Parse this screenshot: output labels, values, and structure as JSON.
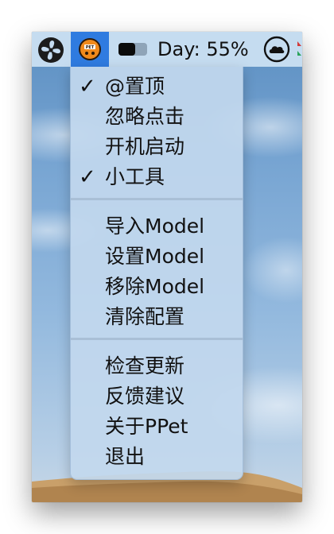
{
  "menubar": {
    "left_icon": "fan-icon",
    "app_icon": "ppet-app-icon",
    "app_icon_text": "PET",
    "battery_icon": "battery-toggle-icon",
    "status_text": "Day: 55%",
    "right_icon": "cloud-icon",
    "accent_color": "#2f7be0"
  },
  "menu": {
    "items": [
      {
        "label": "@置顶",
        "checked": true
      },
      {
        "label": "忽略点击",
        "checked": false
      },
      {
        "label": "开机启动",
        "checked": false
      },
      {
        "label": "小工具",
        "checked": true
      },
      {
        "label": "导入Model",
        "checked": false
      },
      {
        "label": "设置Model",
        "checked": false
      },
      {
        "label": "移除Model",
        "checked": false
      },
      {
        "label": "清除配置",
        "checked": false
      },
      {
        "label": "检查更新",
        "checked": false
      },
      {
        "label": "反馈建议",
        "checked": false
      },
      {
        "label": "关于PPet",
        "checked": false
      },
      {
        "label": "退出",
        "checked": false
      }
    ],
    "checkmark": "✓"
  }
}
